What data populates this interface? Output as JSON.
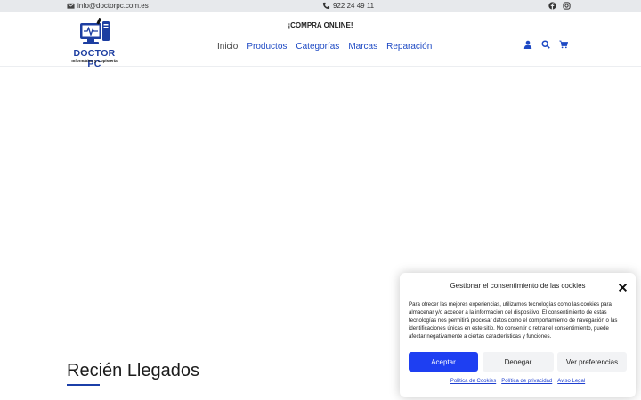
{
  "topbar": {
    "email": "info@doctorpc.com.es",
    "phone": "922 24 49 11",
    "social_icons": [
      "facebook-icon",
      "instagram-icon"
    ]
  },
  "header": {
    "promo": "¡COMPRA ONLINE!",
    "logo": {
      "title": "DOCTOR PC",
      "subtitle": "Informática y Copistería"
    },
    "nav": [
      "Inicio",
      "Productos",
      "Categorías",
      "Marcas",
      "Reparación"
    ],
    "icons": [
      "user-icon",
      "search-icon",
      "cart-icon"
    ]
  },
  "main": {
    "section_title": "Recién Llegados"
  },
  "cookie_modal": {
    "title": "Gestionar el consentimiento de las cookies",
    "text": "Para ofrecer las mejores experiencias, utilizamos tecnologías como las cookies para almacenar y/o acceder a la información del dispositivo. El consentimiento de estas tecnologías nos permitirá procesar datos como el comportamiento de navegación o las identificaciones únicas en este sitio. No consentir o retirar el consentimiento, puede afectar negativamente a ciertas características y funciones.",
    "accept": "Aceptar",
    "deny": "Denegar",
    "preferences": "Ver preferencias",
    "links": [
      "Política de Cookies",
      "Política de privacidad",
      "Aviso Legal"
    ]
  },
  "colors": {
    "brand_blue": "#1d49c4",
    "accept_button": "#1e3ff2",
    "topbar_bg": "#e7e9ec"
  }
}
